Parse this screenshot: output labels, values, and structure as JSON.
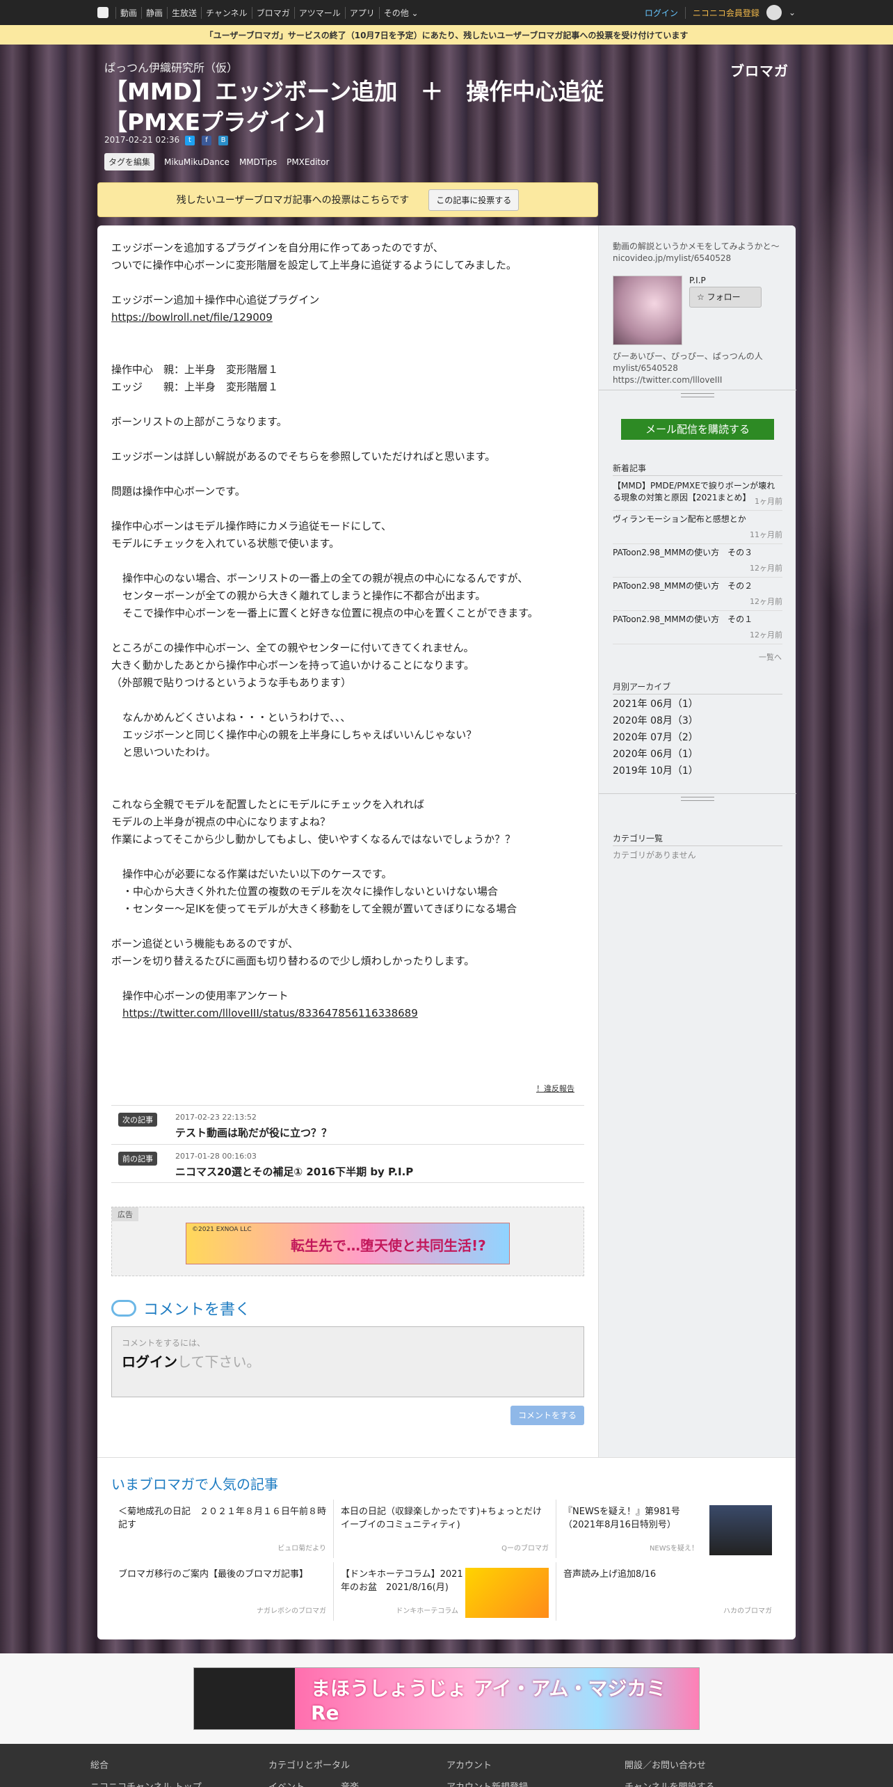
{
  "nicobar": {
    "items": [
      "動画",
      "静画",
      "生放送",
      "チャンネル",
      "ブロマガ",
      "アツマール",
      "アプリ",
      "その他 ⌄"
    ],
    "login": "ログイン",
    "signup": "ニコニコ会員登録"
  },
  "notice": "「ユーザーブロマガ」サービスの終了（10月7日を予定）にあたり、残したいユーザーブロマガ記事への投票を受け付けています",
  "header": {
    "blog_name": "ぱっつん伊織研究所（仮）",
    "brand": "ブロマガ",
    "title": "【MMD】エッジボーン追加　＋　操作中心追従【PMXEプラグイン】",
    "date": "2017-02-21 02:36",
    "tag_edit": "タグを編集",
    "tags": [
      "MikuMikuDance",
      "MMDTips",
      "PMXEditor"
    ]
  },
  "vote": {
    "text": "残したいユーザーブロマガ記事への投票はこちらです",
    "button": "この記事に投票する"
  },
  "article": {
    "paragraphs": [
      "エッジボーンを追加するプラグインを自分用に作ってあったのですが、\nついでに操作中心ボーンに変形階層を設定して上半身に追従するようにしてみました。",
      "エッジボーン追加＋操作中心追従プラグイン",
      "操作中心　親：上半身　変形階層１\nエッジ　　親：上半身　変形階層１",
      "ボーンリストの上部がこうなります。",
      "エッジボーンは詳しい解説があるのでそちらを参照していただければと思います。",
      "問題は操作中心ボーンです。",
      "操作中心ボーンはモデル操作時にカメラ追従モードにして、\nモデルにチェックを入れている状態で使います。",
      "操作中心のない場合、ボーンリストの一番上の全ての親が視点の中心になるんですが、\nセンターボーンが全ての親から大きく離れてしまうと操作に不都合が出ます。\nそこで操作中心ボーンを一番上に置くと好きな位置に視点の中心を置くことができます。",
      "ところがこの操作中心ボーン、全ての親やセンターに付いてきてくれません。\n大きく動かしたあとから操作中心ボーンを持って追いかけることになります。\n（外部親で貼りつけるというような手もあります）",
      "なんかめんどくさいよね・・・というわけで、、、\nエッジボーンと同じく操作中心の親を上半身にしちゃえばいいんじゃない？\nと思いついたわけ。",
      "これなら全親でモデルを配置したとにモデルにチェックを入れれば\nモデルの上半身が視点の中心になりますよね？\n作業によってそこから少し動かしてもよし、使いやすくなるんではないでしょうか？？",
      "操作中心が必要になる作業はだいたい以下のケースです。\n・中心から大きく外れた位置の複数のモデルを次々に操作しないといけない場合\n・センター～足IKを使ってモデルが大きく移動をして全親が置いてきぼりになる場合",
      "ボーン追従という機能もあるのですが、\nボーンを切り替えるたびに画面も切り替わるので少し煩わしかったりします。",
      "操作中心ボーンの使用率アンケート"
    ],
    "link1": "https://bowlroll.net/file/129009",
    "link2": "https://twitter.com/llloveIII/status/833647856116338689"
  },
  "report": "！違反報告",
  "next": {
    "badge": "次の記事",
    "date": "2017-02-23 22:13:52",
    "title": "テスト動画は恥だが役に立つ？？"
  },
  "prev": {
    "badge": "前の記事",
    "date": "2017-01-28 00:16:03",
    "title": "ニコマス20選とその補足① 2016下半期 by P.I.P"
  },
  "ad": {
    "label": "広告",
    "copyright": "©2021 EXNOA LLC",
    "text": "転生先で…堕天使と共同生活!?"
  },
  "comment": {
    "heading": "コメントを書く",
    "hint": "コメントをするには、",
    "login": "ログイン",
    "login_suffix": "して下さい。",
    "button": "コメントをする"
  },
  "sidebar": {
    "desc": "動画の解説というかメモをしてみようかと～nicovideo.jp/mylist/6540528",
    "profile_name": "P.I.P",
    "follow": "☆ フォロー",
    "profile_desc": "ぴーあいぴー、ぴっぴー、ぱっつんの人 mylist/6540528 https://twitter.com/llloveIII",
    "mail": "メール配信を購読する",
    "news_title": "新着記事",
    "news": [
      {
        "title": "【MMD】PMDE/PMXEで捩りボーンが壊れる現象の対策と原因【2021まとめ】",
        "ago": "1ヶ月前"
      },
      {
        "title": "ヴィランモーション配布と感想とか",
        "ago": "11ヶ月前"
      },
      {
        "title": "PAToon2.98_MMMの使い方　その３",
        "ago": "12ヶ月前"
      },
      {
        "title": "PAToon2.98_MMMの使い方　その２",
        "ago": "12ヶ月前"
      },
      {
        "title": "PAToon2.98_MMMの使い方　その１",
        "ago": "12ヶ月前"
      }
    ],
    "more": "一覧へ",
    "archive_title": "月別アーカイブ",
    "archive": [
      "2021年 06月（1）",
      "2020年 08月（3）",
      "2020年 07月（2）",
      "2020年 06月（1）",
      "2019年 10月（1）"
    ],
    "category_title": "カテゴリ一覧",
    "no_category": "カテゴリがありません"
  },
  "popular": {
    "heading": "いまブロマガで人気の記事",
    "items": [
      {
        "title": "＜菊地成孔の日記　２０２１年８月１６日午前８時記す",
        "src": "ビュロ菊だより"
      },
      {
        "title": "本日の日記（収録楽しかったです)+ちょっとだけイーブイのコミュニティティ)",
        "src": "Qーのブロマガ"
      },
      {
        "title": "『NEWSを疑え！』第981号（2021年8月16日特別号）",
        "src": "NEWSを疑え！"
      },
      {
        "title": "ブロマガ移行のご案内【最後のブロマガ記事】",
        "src": "ナガレボシのブロマガ"
      },
      {
        "title": "【ドンキホーテコラム】2021年のお盆　2021/8/16(月)",
        "src": "ドンキホーテコラム"
      },
      {
        "title": "音声読み上げ追加8/16",
        "src": "ハカのブロマガ"
      }
    ]
  },
  "bottom_ad": {
    "text": "まほうしょうじょ アイ・アム・マジカミ Re"
  },
  "footer": {
    "cols": [
      [
        "総合",
        "ニコニコチャンネル トップ"
      ],
      [
        "カテゴリとポータル",
        "イベント　　　　音楽"
      ],
      [
        "アカウント",
        "アカウント新規登録"
      ],
      [
        "開設／お問い合わせ",
        "チャンネルを開設する"
      ]
    ]
  },
  "colors": {
    "accent_blue": "#1e7cc2",
    "notice_yellow": "#fbe9a0",
    "mail_green": "#2d8a24"
  }
}
